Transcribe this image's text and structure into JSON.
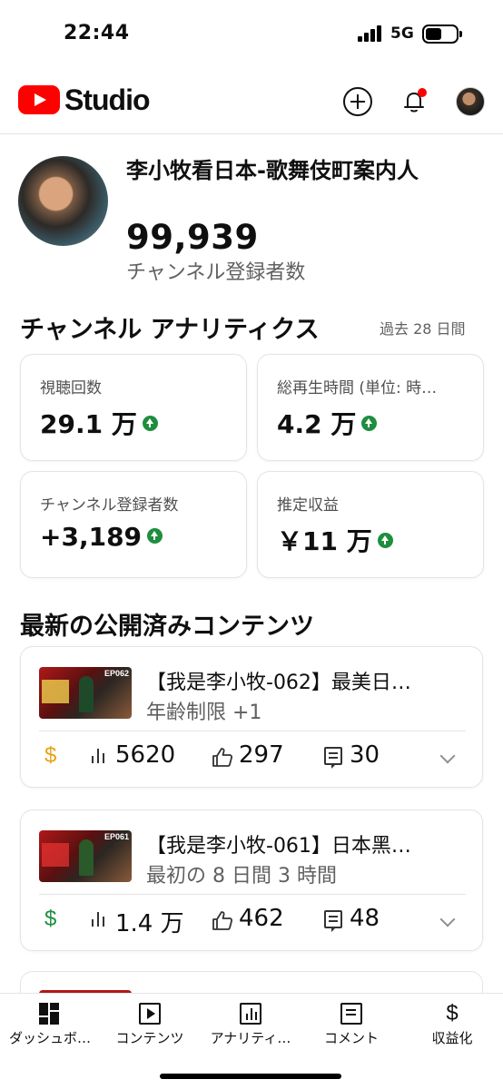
{
  "status_bar": {
    "time": "22:44",
    "network": "5G"
  },
  "app": {
    "name": "Studio"
  },
  "channel": {
    "name": "李小牧看日本-歌舞伎町案内人",
    "subscribers": "99,939",
    "subscribers_label": "チャンネル登録者数"
  },
  "analytics": {
    "title": "チャンネル アナリティクス",
    "period": "過去 28 日間",
    "cards": [
      {
        "label": "視聴回数",
        "value": "29.1 万",
        "trend": "up"
      },
      {
        "label": "総再生時間 (単位: 時…",
        "value": "4.2 万",
        "trend": "up"
      },
      {
        "label": "チャンネル登録者数",
        "value": "+3,189",
        "trend": "up"
      },
      {
        "label": "推定収益",
        "value": "￥11 万",
        "trend": "up"
      }
    ]
  },
  "latest": {
    "title": "最新の公開済みコンテンツ",
    "videos": [
      {
        "thumb_label": "EP062",
        "title": "【我是李小牧-062】最美日…",
        "subtitle": "年齢制限 +1",
        "monetization_icon": "dollar-icon",
        "monetization_color": "#e8a317",
        "views": "5620",
        "likes": "297",
        "comments": "30"
      },
      {
        "thumb_label": "EP061",
        "title": "【我是李小牧-061】日本黑…",
        "subtitle": "最初の 8 日間 3 時間",
        "monetization_icon": "dollar-icon",
        "monetization_color": "#1e8e3e",
        "views": "1.4 万",
        "likes": "462",
        "comments": "48"
      }
    ]
  },
  "bottom_nav": [
    {
      "label": "ダッシュボ…",
      "icon": "dashboard-icon"
    },
    {
      "label": "コンテンツ",
      "icon": "content-icon"
    },
    {
      "label": "アナリティ…",
      "icon": "analytics-icon"
    },
    {
      "label": "コメント",
      "icon": "comment-icon"
    },
    {
      "label": "収益化",
      "icon": "earn-icon"
    }
  ],
  "colors": {
    "brand": "#ff0000",
    "trend_up": "#1e8e3e",
    "secondary_text": "#606060"
  }
}
